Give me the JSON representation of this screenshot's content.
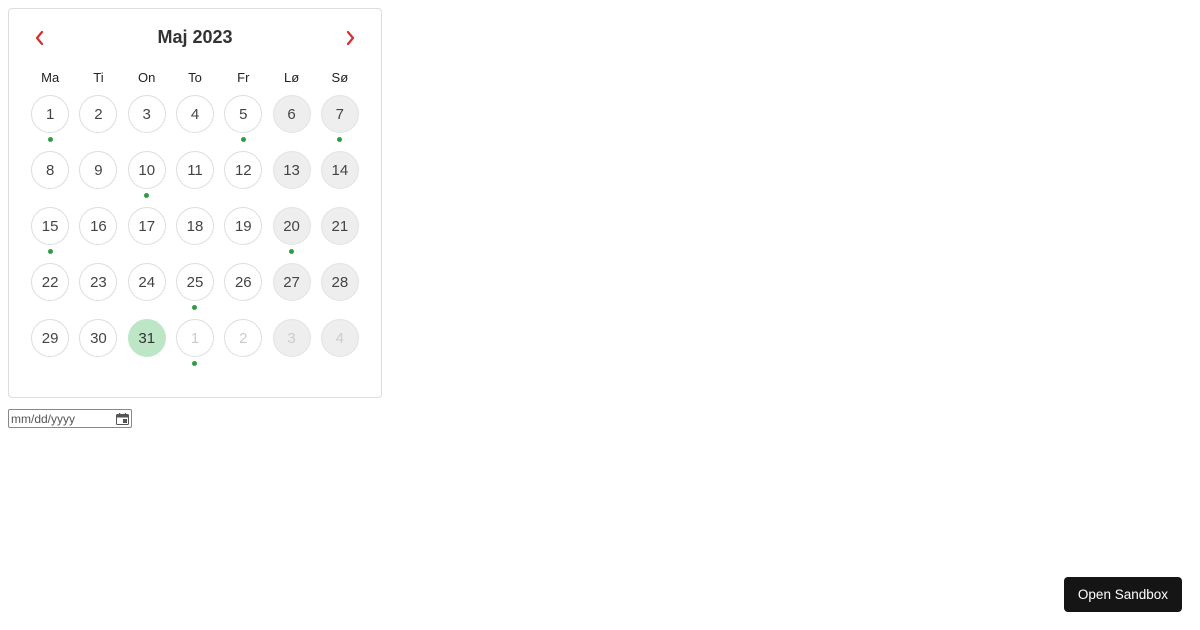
{
  "calendar": {
    "title": "Maj 2023",
    "dow": [
      "Ma",
      "Ti",
      "On",
      "To",
      "Fr",
      "Lø",
      "Sø"
    ],
    "days": [
      {
        "n": 1,
        "weekend": false,
        "muted": false,
        "selected": false,
        "dot": true
      },
      {
        "n": 2,
        "weekend": false,
        "muted": false,
        "selected": false,
        "dot": false
      },
      {
        "n": 3,
        "weekend": false,
        "muted": false,
        "selected": false,
        "dot": false
      },
      {
        "n": 4,
        "weekend": false,
        "muted": false,
        "selected": false,
        "dot": false
      },
      {
        "n": 5,
        "weekend": false,
        "muted": false,
        "selected": false,
        "dot": true
      },
      {
        "n": 6,
        "weekend": true,
        "muted": false,
        "selected": false,
        "dot": false
      },
      {
        "n": 7,
        "weekend": true,
        "muted": false,
        "selected": false,
        "dot": true
      },
      {
        "n": 8,
        "weekend": false,
        "muted": false,
        "selected": false,
        "dot": false
      },
      {
        "n": 9,
        "weekend": false,
        "muted": false,
        "selected": false,
        "dot": false
      },
      {
        "n": 10,
        "weekend": false,
        "muted": false,
        "selected": false,
        "dot": true
      },
      {
        "n": 11,
        "weekend": false,
        "muted": false,
        "selected": false,
        "dot": false
      },
      {
        "n": 12,
        "weekend": false,
        "muted": false,
        "selected": false,
        "dot": false
      },
      {
        "n": 13,
        "weekend": true,
        "muted": false,
        "selected": false,
        "dot": false
      },
      {
        "n": 14,
        "weekend": true,
        "muted": false,
        "selected": false,
        "dot": false
      },
      {
        "n": 15,
        "weekend": false,
        "muted": false,
        "selected": false,
        "dot": true
      },
      {
        "n": 16,
        "weekend": false,
        "muted": false,
        "selected": false,
        "dot": false
      },
      {
        "n": 17,
        "weekend": false,
        "muted": false,
        "selected": false,
        "dot": false
      },
      {
        "n": 18,
        "weekend": false,
        "muted": false,
        "selected": false,
        "dot": false
      },
      {
        "n": 19,
        "weekend": false,
        "muted": false,
        "selected": false,
        "dot": false
      },
      {
        "n": 20,
        "weekend": true,
        "muted": false,
        "selected": false,
        "dot": true
      },
      {
        "n": 21,
        "weekend": true,
        "muted": false,
        "selected": false,
        "dot": false
      },
      {
        "n": 22,
        "weekend": false,
        "muted": false,
        "selected": false,
        "dot": false
      },
      {
        "n": 23,
        "weekend": false,
        "muted": false,
        "selected": false,
        "dot": false
      },
      {
        "n": 24,
        "weekend": false,
        "muted": false,
        "selected": false,
        "dot": false
      },
      {
        "n": 25,
        "weekend": false,
        "muted": false,
        "selected": false,
        "dot": true
      },
      {
        "n": 26,
        "weekend": false,
        "muted": false,
        "selected": false,
        "dot": false
      },
      {
        "n": 27,
        "weekend": true,
        "muted": false,
        "selected": false,
        "dot": false
      },
      {
        "n": 28,
        "weekend": true,
        "muted": false,
        "selected": false,
        "dot": false
      },
      {
        "n": 29,
        "weekend": false,
        "muted": false,
        "selected": false,
        "dot": false
      },
      {
        "n": 30,
        "weekend": false,
        "muted": false,
        "selected": false,
        "dot": false
      },
      {
        "n": 31,
        "weekend": false,
        "muted": false,
        "selected": true,
        "dot": false
      },
      {
        "n": 1,
        "weekend": false,
        "muted": true,
        "selected": false,
        "dot": true
      },
      {
        "n": 2,
        "weekend": false,
        "muted": true,
        "selected": false,
        "dot": false
      },
      {
        "n": 3,
        "weekend": true,
        "muted": true,
        "selected": false,
        "dot": false
      },
      {
        "n": 4,
        "weekend": true,
        "muted": true,
        "selected": false,
        "dot": false
      }
    ]
  },
  "date_input": {
    "placeholder": "mm/dd/yyyy",
    "value": ""
  },
  "footer": {
    "open_sandbox": "Open Sandbox"
  },
  "colors": {
    "accent_red": "#d32f2f",
    "dot_green": "#2e9e44",
    "selected_green": "#bde6c6"
  }
}
